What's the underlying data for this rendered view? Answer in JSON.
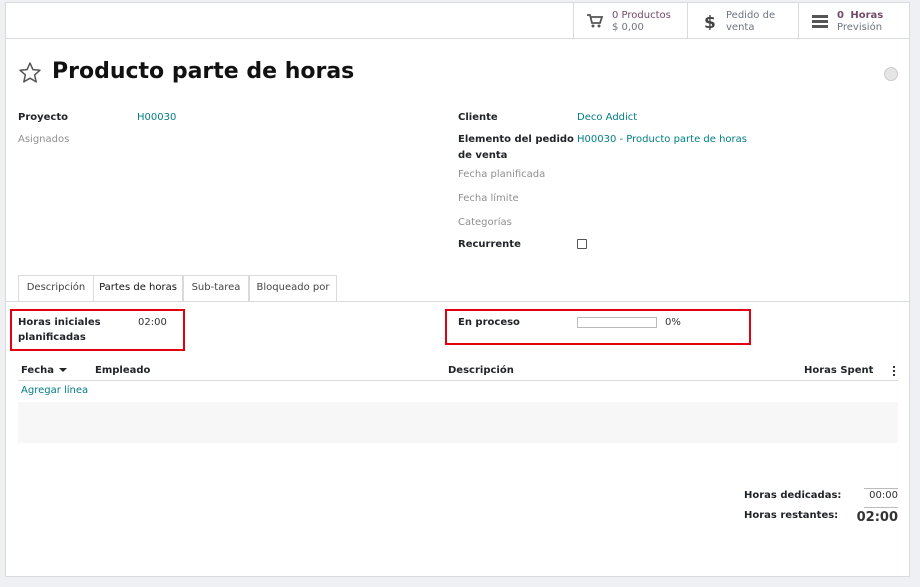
{
  "smart_buttons": {
    "products": {
      "count_label": "0 Productos",
      "amount": "$ 0,00",
      "icon": "cart-icon"
    },
    "sale_order": {
      "line1": "Pedido de",
      "line2": "venta",
      "icon": "dollar-icon"
    },
    "hours": {
      "count": "0",
      "label1": "Horas",
      "label2": "Previsión",
      "icon": "server-icon"
    }
  },
  "record": {
    "title": "Producto parte de horas"
  },
  "fields_left": {
    "project_label": "Proyecto",
    "project_value": "H00030",
    "assignees_label": "Asignados"
  },
  "fields_right": {
    "customer_label": "Cliente",
    "customer_value": "Deco Addict",
    "sale_line_label_1": "Elemento del pedido",
    "sale_line_label_2": "de venta",
    "sale_line_value": "H00030 - Producto parte de horas",
    "planned_date_label": "Fecha planificada",
    "deadline_label": "Fecha límite",
    "tags_label": "Categorías",
    "recurrent_label": "Recurrente"
  },
  "tabs": [
    {
      "label": "Descripción"
    },
    {
      "label": "Partes de horas"
    },
    {
      "label": "Sub-tarea"
    },
    {
      "label": "Bloqueado por"
    }
  ],
  "timesheet": {
    "initial_hours_label_1": "Horas iniciales",
    "initial_hours_label_2": "planificadas",
    "initial_hours_value": "02:00",
    "progress_label": "En proceso",
    "progress_value": "0%",
    "progress_fraction": 0,
    "columns": {
      "date": "Fecha",
      "employee": "Empleado",
      "description": "Descripción",
      "hours": "Horas Spent"
    },
    "add_line": "Agregar línea"
  },
  "totals": {
    "spent_label": "Horas dedicadas:",
    "spent_value": "00:00",
    "remaining_label": "Horas restantes:",
    "remaining_value": "02:00"
  }
}
